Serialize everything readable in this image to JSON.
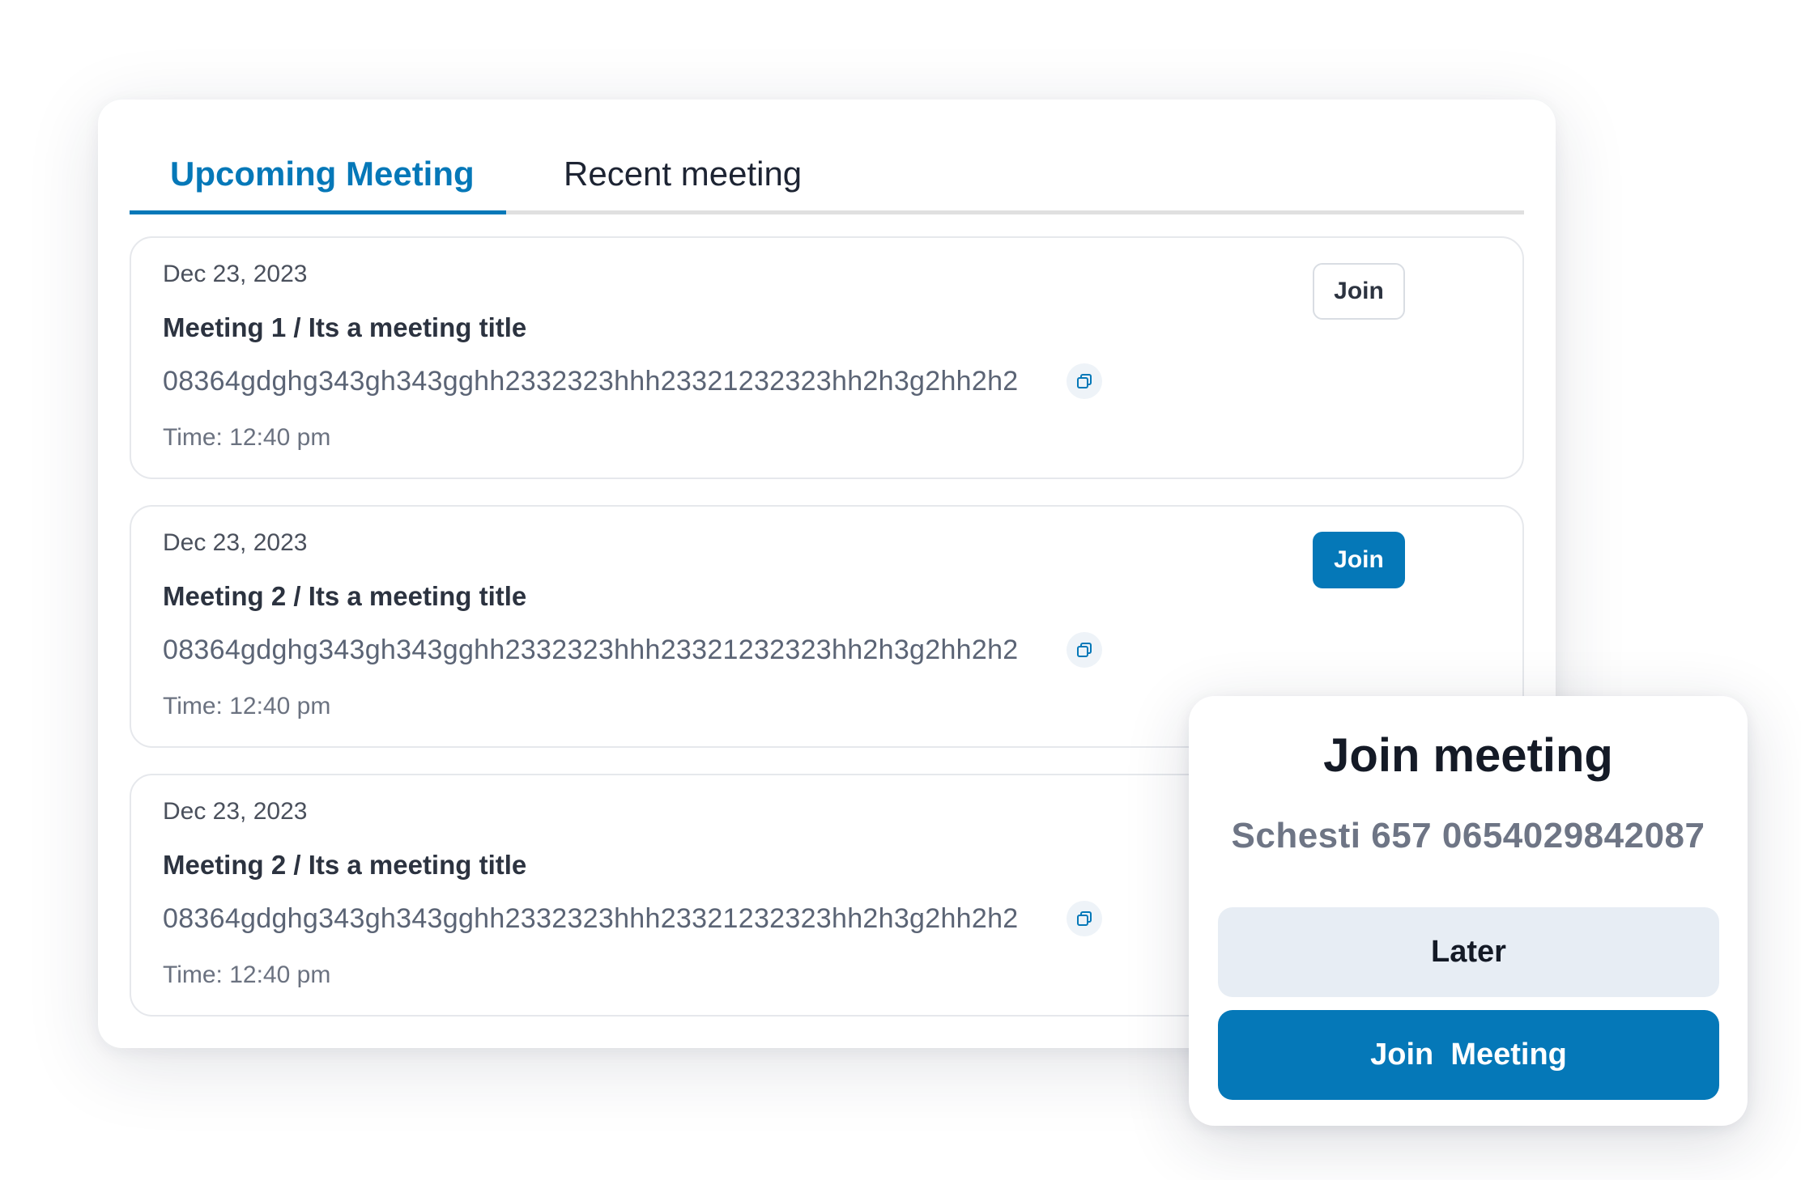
{
  "tabs": {
    "upcoming_label": "Upcoming Meeting",
    "recent_label": "Recent meeting",
    "active": "upcoming"
  },
  "meetings": [
    {
      "date": "Dec 23, 2023",
      "title": "Meeting 1 / Its a meeting title",
      "id": "08364gdghg343gh343gghh2332323hhh23321232323hh2h3g2hh2h2",
      "time": "Time: 12:40 pm",
      "join_label": "Join",
      "join_style": "outline"
    },
    {
      "date": "Dec 23, 2023",
      "title": "Meeting 2 / Its a meeting title",
      "id": "08364gdghg343gh343gghh2332323hhh23321232323hh2h3g2hh2h2",
      "time": "Time: 12:40 pm",
      "join_label": "Join",
      "join_style": "filled"
    },
    {
      "date": "Dec 23, 2023",
      "title": "Meeting 2 / Its a meeting title",
      "id": "08364gdghg343gh343gghh2332323hhh23321232323hh2h3g2hh2h2",
      "time": "Time: 12:40 pm"
    }
  ],
  "icons": {
    "copy": "copy-icon"
  },
  "modal": {
    "title": "Join meeting",
    "code": "Schesti 657 0654029842087",
    "later_label": "Later",
    "join_label": "Join  Meeting"
  },
  "colors": {
    "accent": "#0578b8",
    "later_bg": "#e7edf4",
    "text_dark": "#141a26"
  }
}
